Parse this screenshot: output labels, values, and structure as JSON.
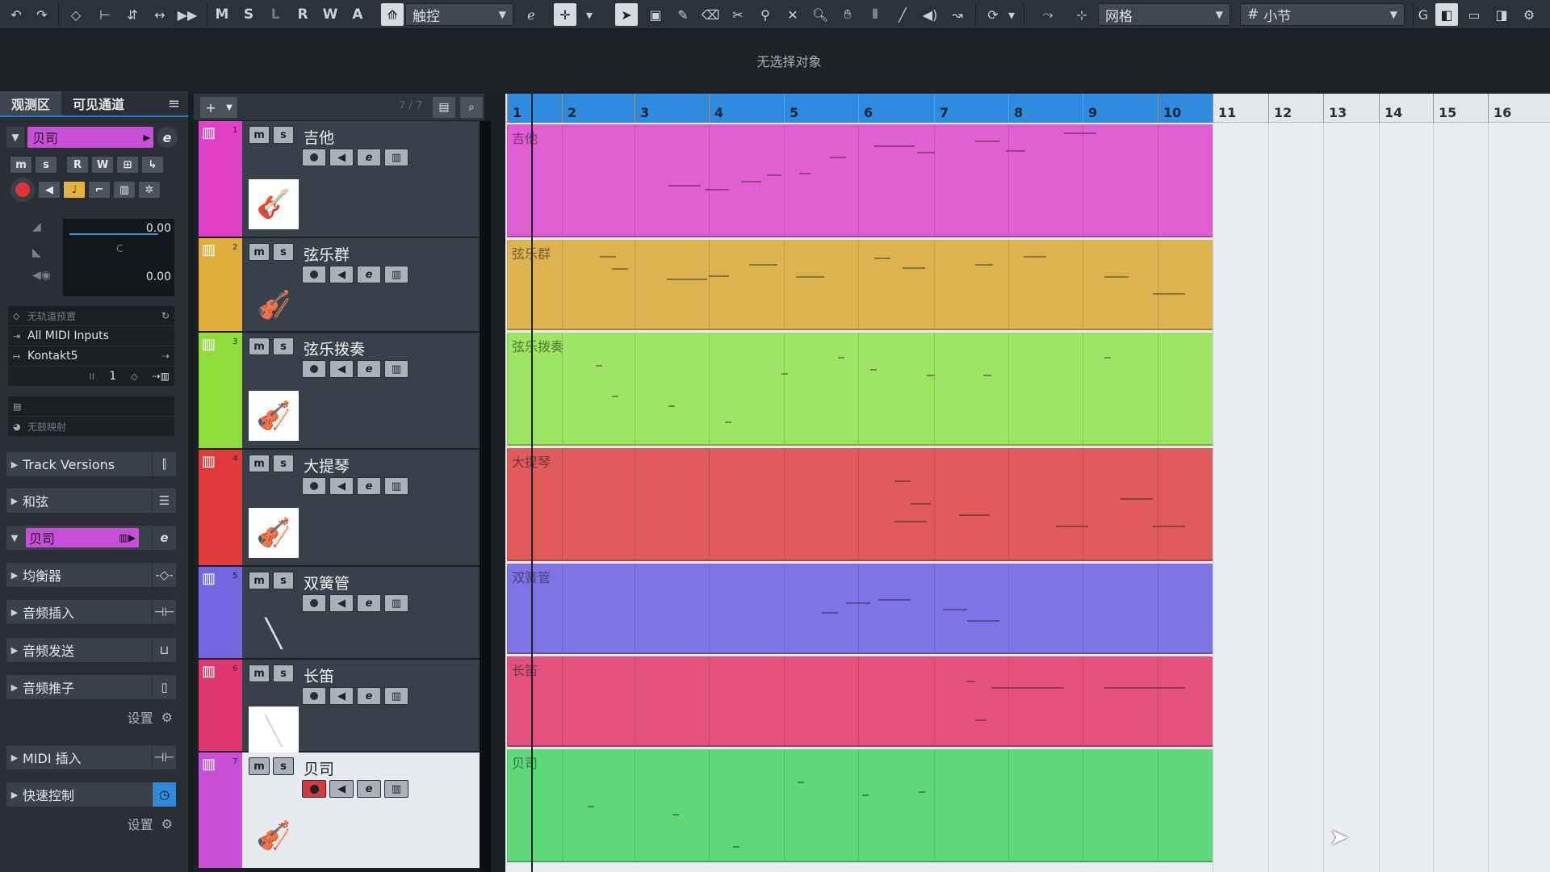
{
  "toolbar": {
    "letters": [
      "M",
      "S",
      "L",
      "R",
      "W",
      "A"
    ],
    "touch_mode": "触控",
    "snap_type": "网格",
    "grid_type": "小节"
  },
  "infobar": {
    "message": "无选择对象"
  },
  "inspector": {
    "tabs": [
      "观测区",
      "可见通道"
    ],
    "menu_icon": "menu-icon",
    "track_name": "贝司",
    "volume_value": "0.00",
    "pan_label": "C",
    "pan_value": "0.00",
    "routing": {
      "preset": "无轨道预置",
      "midi_input": "All MIDI Inputs",
      "output": "Kontakt5",
      "channel": "1",
      "mapping": "无鼓映射"
    },
    "sections": [
      "Track Versions",
      "和弦",
      "贝司",
      "均衡器",
      "音频插入",
      "音频发送",
      "音频推子"
    ],
    "settings_label": "设置",
    "sections2": [
      "MIDI 插入",
      "快速控制"
    ]
  },
  "tracklist": {
    "count": "7 / 7",
    "tracks": [
      {
        "num": "1",
        "name": "吉他",
        "color": "#e040c8"
      },
      {
        "num": "2",
        "name": "弦乐群",
        "color": "#e1ae3c"
      },
      {
        "num": "3",
        "name": "弦乐拨奏",
        "color": "#8fdd3a"
      },
      {
        "num": "4",
        "name": "大提琴",
        "color": "#e03a3a"
      },
      {
        "num": "5",
        "name": "双簧管",
        "color": "#7466e0"
      },
      {
        "num": "6",
        "name": "长笛",
        "color": "#e0356e"
      },
      {
        "num": "7",
        "name": "贝司",
        "color": "#c94fd9"
      }
    ],
    "button_m": "m",
    "button_s": "s",
    "button_e": "e"
  },
  "ruler": {
    "bars": [
      "1",
      "2",
      "3",
      "4",
      "5",
      "6",
      "7",
      "8",
      "9",
      "10",
      "11",
      "12",
      "13",
      "14",
      "15",
      "16"
    ]
  },
  "parts": [
    {
      "label": "吉他",
      "color": "#e15ed2"
    },
    {
      "label": "弦乐群",
      "color": "#ddb34f"
    },
    {
      "label": "弦乐拨奏",
      "color": "#9ee462"
    },
    {
      "label": "大提琴",
      "color": "#e15b5b"
    },
    {
      "label": "双簧管",
      "color": "#7f74e6"
    },
    {
      "label": "长笛",
      "color": "#e3517f"
    },
    {
      "label": "贝司",
      "color": "#5fd87a"
    }
  ]
}
